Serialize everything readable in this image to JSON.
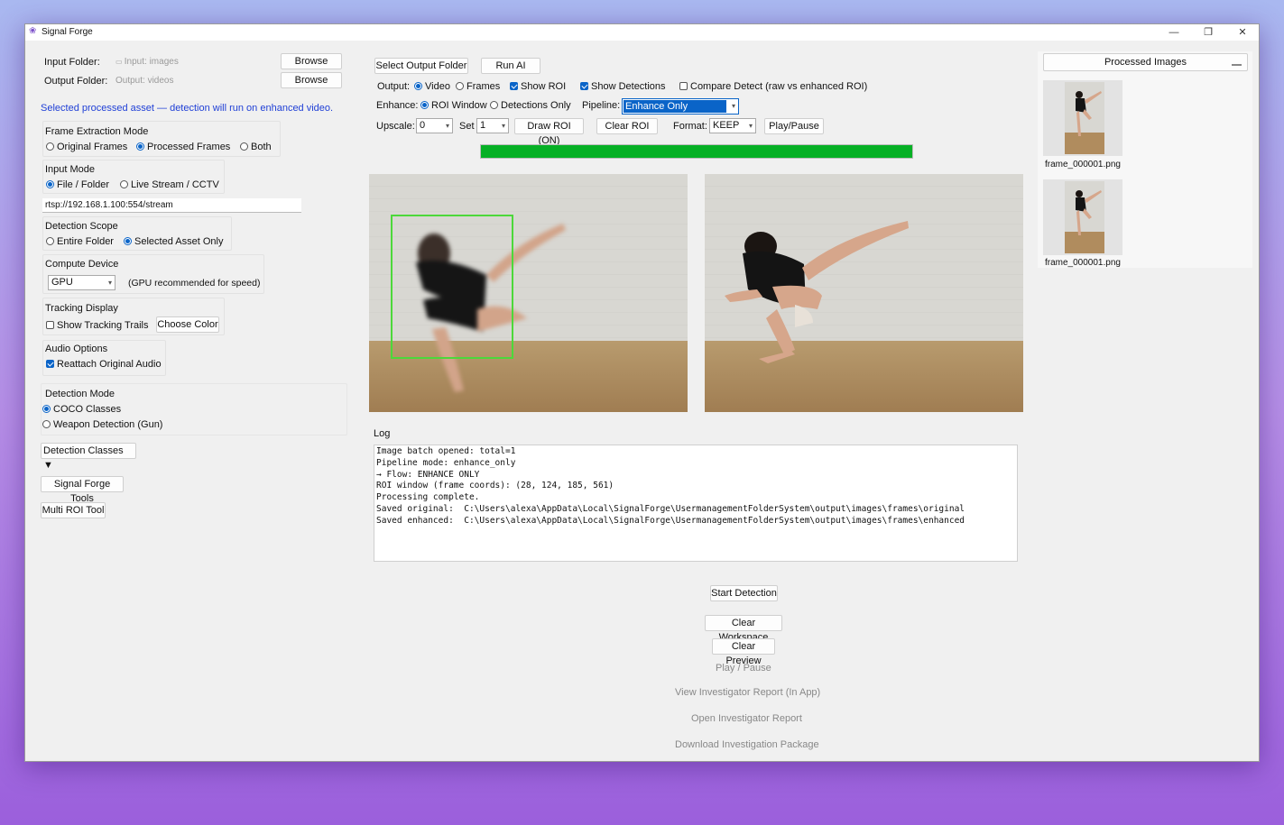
{
  "window": {
    "title": "Signal Forge",
    "minimize": "—",
    "restore": "❐",
    "close": "✕"
  },
  "left": {
    "input_folder_label": "Input Folder:",
    "input_folder_value": "Input: images",
    "output_folder_label": "Output Folder:",
    "output_folder_value": "Output: videos",
    "browse_label": "Browse",
    "notice": "Selected processed asset — detection will run on enhanced video.",
    "frame_extraction": {
      "title": "Frame Extraction Mode",
      "options": [
        "Original Frames",
        "Processed Frames",
        "Both"
      ],
      "selected": "Processed Frames"
    },
    "input_mode": {
      "title": "Input Mode",
      "options": [
        "File / Folder",
        "Live Stream / CCTV"
      ],
      "selected": "File / Folder",
      "stream_url": "rtsp://192.168.1.100:554/stream"
    },
    "detection_scope": {
      "title": "Detection Scope",
      "options": [
        "Entire Folder",
        "Selected Asset Only"
      ],
      "selected": "Selected Asset Only"
    },
    "compute_device": {
      "title": "Compute Device",
      "value": "GPU",
      "hint": "(GPU recommended for speed)"
    },
    "tracking_display": {
      "title": "Tracking Display",
      "trails_label": "Show Tracking Trails",
      "trails_checked": false,
      "choose_color": "Choose Color"
    },
    "audio_options": {
      "title": "Audio Options",
      "reattach_label": "Reattach Original Audio",
      "reattach_checked": true
    },
    "detection_mode": {
      "title": "Detection Mode",
      "options": [
        "COCO Classes",
        "Weapon Detection (Gun)"
      ],
      "selected": "COCO Classes"
    },
    "detection_classes": "Detection Classes ▼",
    "tools_button": "Signal Forge Tools",
    "multi_roi_button": "Multi ROI Tool"
  },
  "toolbar": {
    "select_output_folder": "Select Output Folder",
    "run_ai": "Run AI",
    "output_label": "Output:",
    "output_options": [
      "Video",
      "Frames"
    ],
    "output_selected": "Video",
    "show_roi": "Show ROI",
    "show_detections": "Show Detections",
    "compare_detect": "Compare Detect (raw vs enhanced ROI)",
    "enhance_label": "Enhance:",
    "enhance_options": [
      "ROI Window",
      "Detections Only"
    ],
    "enhance_selected": "ROI Window",
    "pipeline_label": "Pipeline:",
    "pipeline_value": "Enhance Only",
    "upscale_label": "Upscale:",
    "upscale_value": "0",
    "set_label": "Set",
    "set_value": "1",
    "draw_roi": "Draw ROI (ON)",
    "clear_roi": "Clear ROI",
    "format_label": "Format:",
    "format_value": "KEEP",
    "play_pause": "Play/Pause",
    "progress": 1.0,
    "progress_color": "#06b025"
  },
  "log": {
    "title": "Log",
    "text": "Image batch opened: total=1\nPipeline mode: enhance_only\n→ Flow: ENHANCE ONLY\nROI window (frame coords): (28, 124, 185, 561)\nProcessing complete.\nSaved original:  C:\\Users\\alexa\\AppData\\Local\\SignalForge\\UsermanagementFolderSystem\\output\\images\\frames\\original\nSaved enhanced:  C:\\Users\\alexa\\AppData\\Local\\SignalForge\\UsermanagementFolderSystem\\output\\images\\frames\\enhanced"
  },
  "actions": {
    "start_detection": "Start Detection",
    "clear_workspace": "Clear Workspace",
    "clear_preview": "Clear Preview",
    "play_pause": "Play / Pause",
    "view_report": "View Investigator Report (In App)",
    "open_report": "Open Investigator Report",
    "download_package": "Download Investigation Package"
  },
  "processed": {
    "title": "Processed Images",
    "items": [
      {
        "caption": "frame_000001.png"
      },
      {
        "caption": "frame_000001.png"
      }
    ]
  },
  "colors": {
    "accent": "#0a64c8",
    "roi_box": "#4cd83a",
    "notice": "#1f3fd6"
  }
}
